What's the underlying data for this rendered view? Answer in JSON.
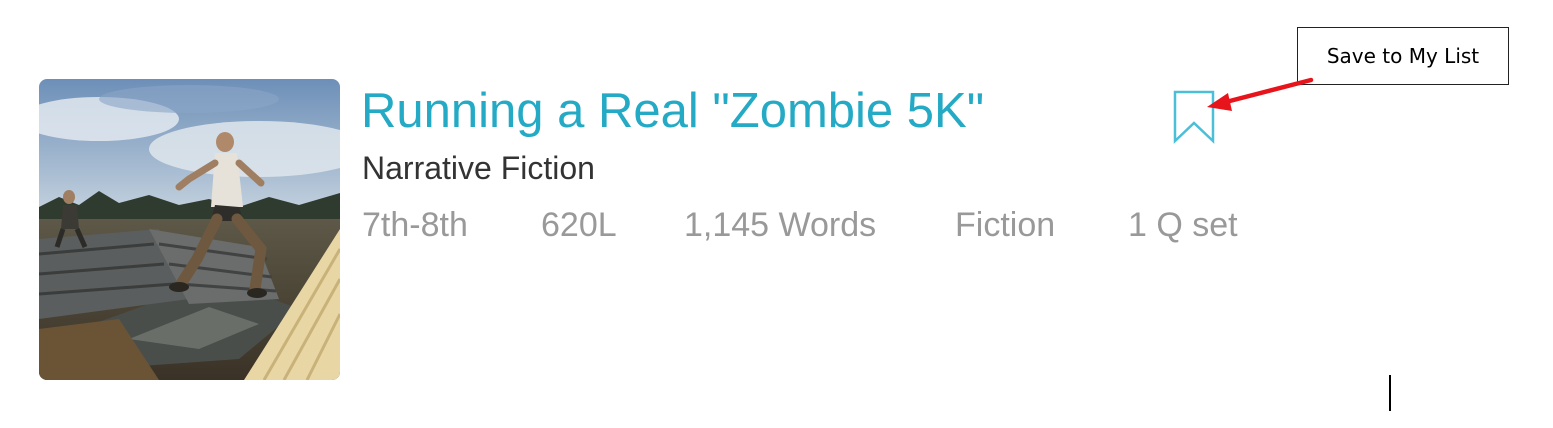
{
  "article": {
    "title": "Running a Real \"Zombie 5K\"",
    "genre": "Narrative Fiction",
    "meta": {
      "grade": "7th-8th",
      "lexile": "620L",
      "word_count": "1,145 Words",
      "category": "Fiction",
      "question_sets": "1 Q set"
    },
    "thumbnail_icon": "runner-photo",
    "bookmark_icon": "bookmark-icon"
  },
  "annotation": {
    "callout_text": "Save to My List",
    "arrow_color": "#e8141b"
  },
  "colors": {
    "title": "#24aac5",
    "genre": "#333333",
    "meta": "#999999",
    "bookmark": "#4bbfd8"
  }
}
